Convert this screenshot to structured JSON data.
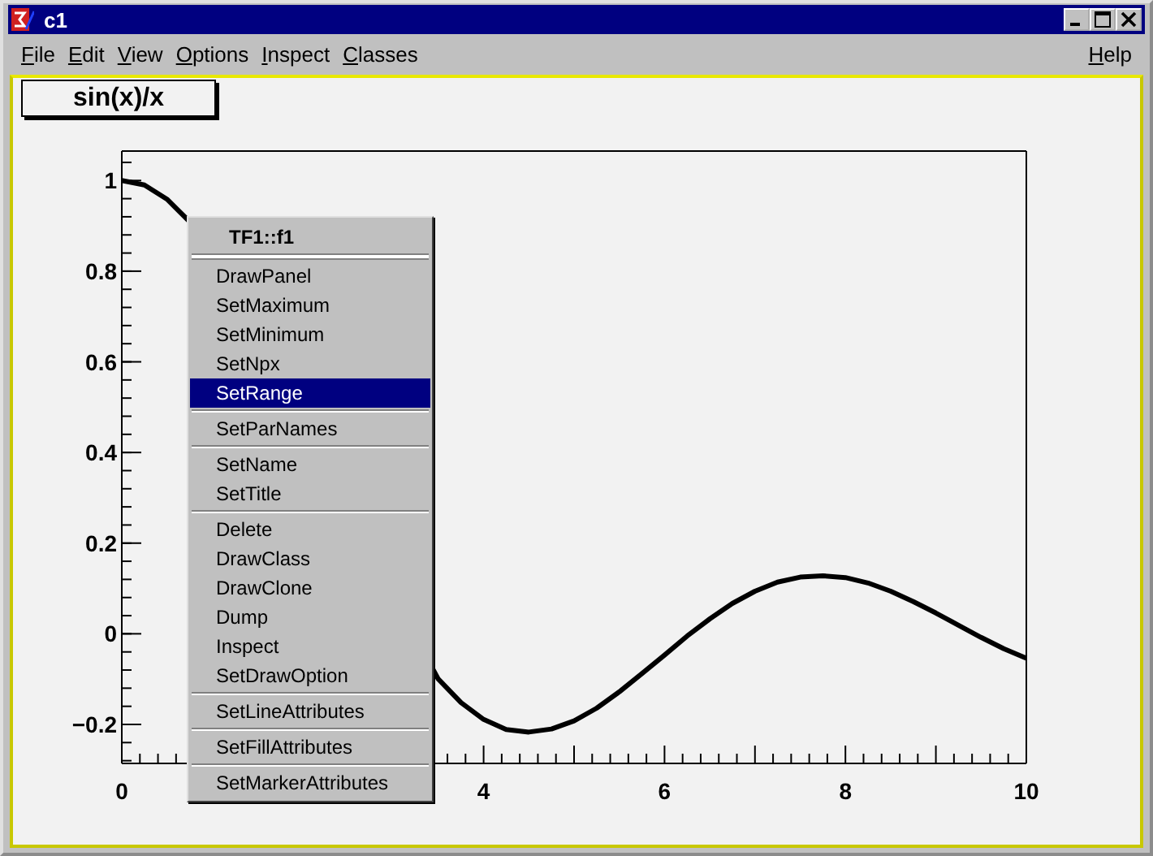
{
  "window": {
    "title": "c1"
  },
  "menubar": {
    "items": [
      {
        "label": "File"
      },
      {
        "label": "Edit"
      },
      {
        "label": "View"
      },
      {
        "label": "Options"
      },
      {
        "label": "Inspect"
      },
      {
        "label": "Classes"
      }
    ],
    "help": "Help"
  },
  "canvas": {
    "title_box": "sin(x)/x",
    "chart_data": {
      "type": "line",
      "x": [
        0,
        0.25,
        0.5,
        0.75,
        3.5,
        3.75,
        4,
        4.25,
        4.5,
        4.75,
        5,
        5.25,
        5.5,
        5.75,
        6,
        6.25,
        6.5,
        6.75,
        7,
        7.25,
        7.5,
        7.75,
        8,
        8.25,
        8.5,
        8.75,
        9,
        9.25,
        9.5,
        9.75,
        10
      ],
      "series": [
        {
          "color": "#000000",
          "values": [
            1,
            0.99,
            0.959,
            0.909,
            -0.1,
            -0.152,
            -0.189,
            -0.211,
            -0.217,
            -0.21,
            -0.192,
            -0.164,
            -0.128,
            -0.088,
            -0.047,
            -0.005,
            0.033,
            0.067,
            0.094,
            0.114,
            0.125,
            0.128,
            0.124,
            0.112,
            0.094,
            0.071,
            0.046,
            0.019,
            -0.008,
            -0.033,
            -0.054
          ]
        }
      ],
      "xlim": [
        0,
        10
      ],
      "ylim": [
        -0.286,
        1.065
      ],
      "xticks": [
        0,
        4,
        6,
        8,
        10
      ],
      "yticks": [
        {
          "value": 1,
          "label": "1"
        },
        {
          "value": 0.8,
          "label": "0.8"
        },
        {
          "value": 0.6,
          "label": "0.6"
        },
        {
          "value": 0.4,
          "label": "0.4"
        },
        {
          "value": 0.2,
          "label": "0.2"
        },
        {
          "value": 0,
          "label": "0"
        },
        {
          "value": -0.2,
          "label": "−0.2"
        }
      ]
    }
  },
  "context_menu": {
    "title": "TF1::f1",
    "groups": [
      [
        {
          "label": "DrawPanel",
          "selected": false
        },
        {
          "label": "SetMaximum",
          "selected": false
        },
        {
          "label": "SetMinimum",
          "selected": false
        },
        {
          "label": "SetNpx",
          "selected": false
        },
        {
          "label": "SetRange",
          "selected": true
        }
      ],
      [
        {
          "label": "SetParNames",
          "selected": false
        }
      ],
      [
        {
          "label": "SetName",
          "selected": false
        },
        {
          "label": "SetTitle",
          "selected": false
        }
      ],
      [
        {
          "label": "Delete",
          "selected": false
        },
        {
          "label": "DrawClass",
          "selected": false
        },
        {
          "label": "DrawClone",
          "selected": false
        },
        {
          "label": "Dump",
          "selected": false
        },
        {
          "label": "Inspect",
          "selected": false
        },
        {
          "label": "SetDrawOption",
          "selected": false
        }
      ],
      [
        {
          "label": "SetLineAttributes",
          "selected": false
        }
      ],
      [
        {
          "label": "SetFillAttributes",
          "selected": false
        }
      ],
      [
        {
          "label": "SetMarkerAttributes",
          "selected": false
        }
      ]
    ]
  }
}
